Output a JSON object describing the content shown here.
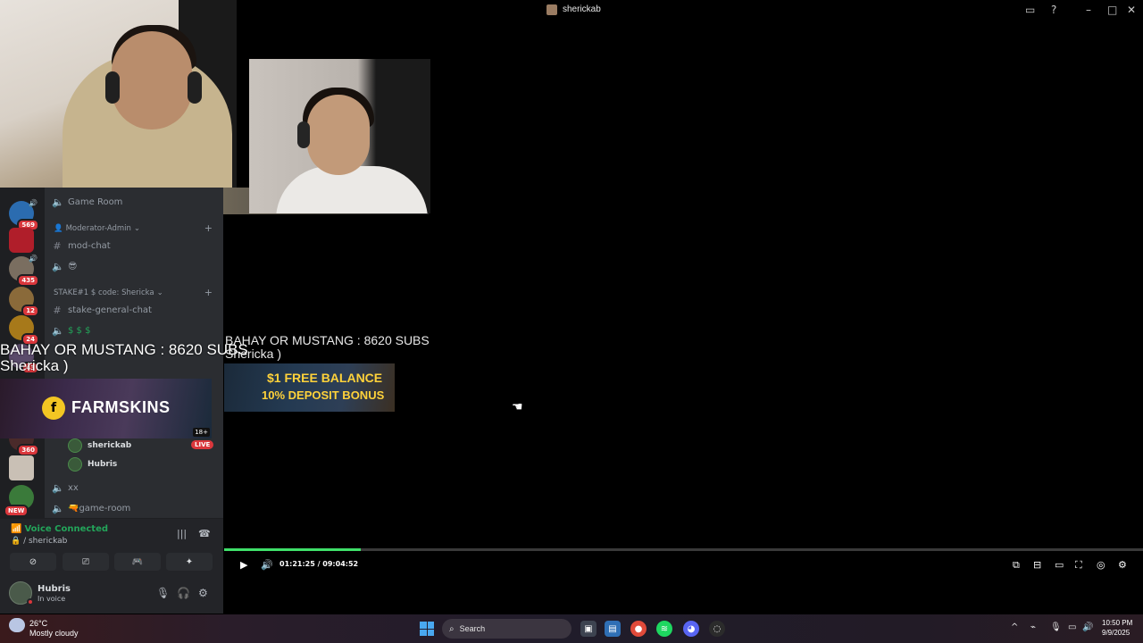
{
  "window": {
    "title": "sherickab"
  },
  "sidebar": {
    "server_badges": [
      "569",
      "435",
      "12",
      "24",
      "43",
      "360",
      "NEW"
    ],
    "channels": [
      {
        "label": "Game Room",
        "type": "voice"
      },
      {
        "label": "mod-chat",
        "type": "text"
      },
      {
        "label": "😎",
        "type": "voice"
      },
      {
        "label": "stake-general-chat",
        "type": "text"
      },
      {
        "label": "$ $ $",
        "type": "voice"
      },
      {
        "label": "xx",
        "type": "voice"
      },
      {
        "label": "🔫game-room",
        "type": "voice"
      }
    ],
    "categories": [
      {
        "label": "Moderator-Admin"
      },
      {
        "label": "STAKE#1 $ code: Shericka"
      }
    ],
    "voice_users": [
      {
        "name": "sherickab",
        "badge": "LIVE"
      },
      {
        "name": "Hubris"
      }
    ]
  },
  "voice": {
    "status": "Voice Connected",
    "channel": "/ sherickab"
  },
  "user": {
    "name": "Hubris",
    "status": "In voice"
  },
  "overlay": {
    "line1": "BAHAY OR MUSTANG : 8620 SUBS",
    "line2": "Shericka )",
    "ad1_brand": "FARMSKINS",
    "ad1_age": "18+",
    "ad2_line1": "$1 FREE BALANCE",
    "ad2_line2": "10% DEPOSIT BONUS"
  },
  "player": {
    "time": "01:21:25 / 09:04:52",
    "progress": 0.149
  },
  "taskbar": {
    "temperature": "26°C",
    "weather": "Mostly cloudy",
    "search": "Search",
    "time": "10:50 PM",
    "date": "9/9/2025"
  },
  "colors": {
    "progress": "#3fe06a",
    "live": "#da373c",
    "voice_connected": "#23a55a"
  }
}
